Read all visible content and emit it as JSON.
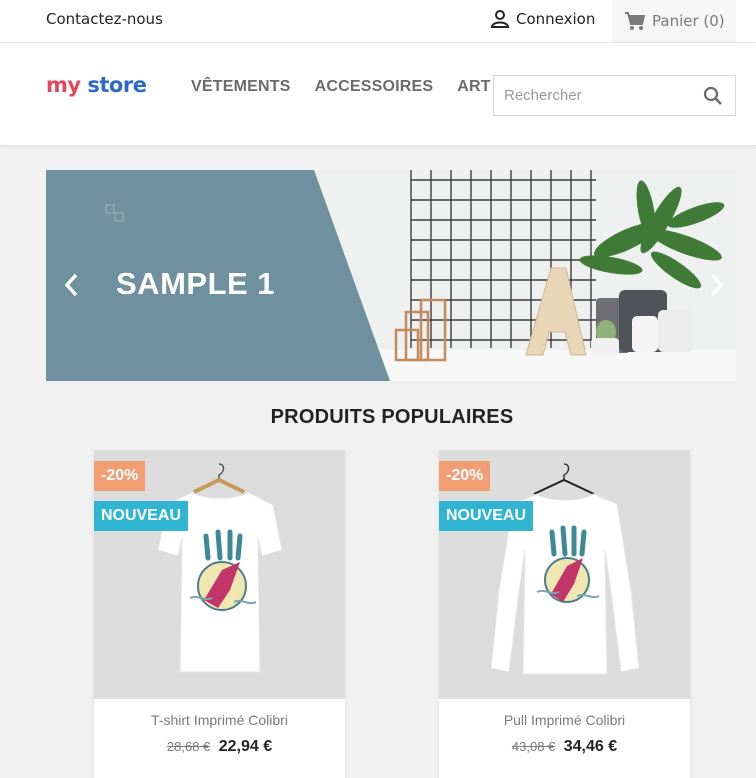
{
  "topbar": {
    "contact": "Contactez-nous",
    "login": "Connexion",
    "cart": "Panier (0)"
  },
  "header": {
    "logo": {
      "word1": "my",
      "word2": "store"
    },
    "menu": [
      "VÊTEMENTS",
      "ACCESSOIRES",
      "ART"
    ],
    "search_placeholder": "Rechercher"
  },
  "banner": {
    "title": "SAMPLE 1"
  },
  "section": {
    "title": "PRODUITS POPULAIRES"
  },
  "products": [
    {
      "name": "T-shirt Imprimé Colibri",
      "old_price": "28,68 €",
      "price": "22,94 €",
      "discount": "-20%",
      "flag": "NOUVEAU"
    },
    {
      "name": "Pull Imprimé Colibri",
      "old_price": "43,08 €",
      "price": "34,46 €",
      "discount": "-20%",
      "flag": "NOUVEAU"
    }
  ],
  "colors": {
    "accent": "#2fb5d2",
    "discount": "#f39d72",
    "banner_panel": "#6f909e"
  },
  "icons": [
    "person-icon",
    "cart-icon",
    "search-icon",
    "chevron-left-icon",
    "chevron-right-icon"
  ]
}
